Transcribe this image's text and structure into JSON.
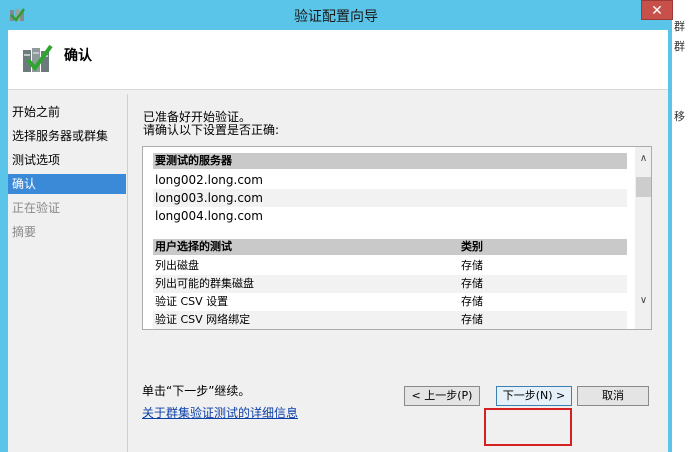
{
  "window": {
    "title": "验证配置向导",
    "close_glyph": "✕"
  },
  "header": {
    "title": "确认"
  },
  "nav": {
    "items": [
      {
        "label": "开始之前",
        "state": "normal"
      },
      {
        "label": "选择服务器或群集",
        "state": "normal"
      },
      {
        "label": "测试选项",
        "state": "normal"
      },
      {
        "label": "确认",
        "state": "selected"
      },
      {
        "label": "正在验证",
        "state": "disabled"
      },
      {
        "label": "摘要",
        "state": "disabled"
      }
    ]
  },
  "content": {
    "intro_line1": "已准备好开始验证。",
    "intro_line2": "请确认以下设置是否正确:",
    "servers_heading": "要测试的服务器",
    "servers": [
      "long002.long.com",
      "long003.long.com",
      "long004.long.com"
    ],
    "tests_heading": "用户选择的测试",
    "category_heading": "类别",
    "tests": [
      {
        "name": "列出磁盘",
        "category": "存储"
      },
      {
        "name": "列出可能的群集磁盘",
        "category": "存储"
      },
      {
        "name": "验证 CSV 设置",
        "category": "存储"
      },
      {
        "name": "验证 CSV 网络绑定",
        "category": "存储"
      }
    ],
    "scroll_up_glyph": "∧",
    "scroll_down_glyph": "∨",
    "next_hint": "单击“下一步”继续。",
    "more_info_link": "关于群集验证测试的详细信息"
  },
  "buttons": {
    "prev": "< 上一步(P)",
    "next": "下一步(N) >",
    "cancel": "取消"
  },
  "background_window": {
    "chars": [
      "群",
      "群",
      "移"
    ]
  },
  "colors": {
    "accent": "#5bc5e9",
    "selection": "#3b8ad8",
    "highlight": "#d42020"
  }
}
